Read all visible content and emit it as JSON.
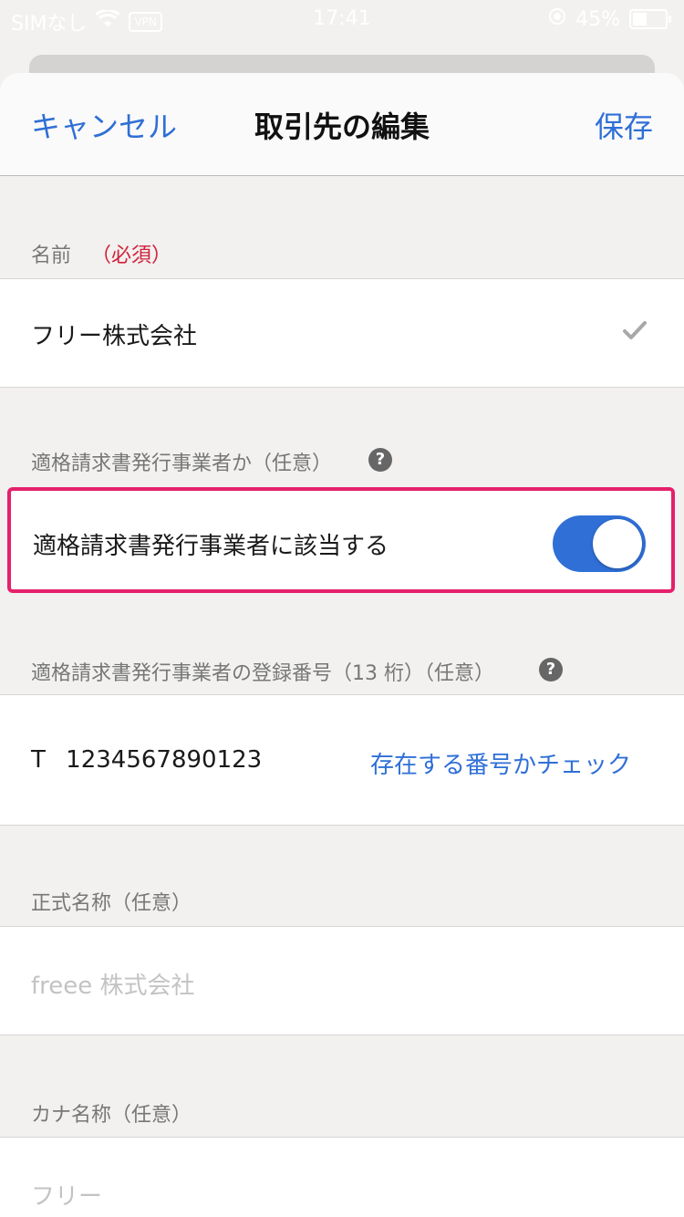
{
  "status_bar": {
    "carrier": "SIMなし",
    "vpn": "VPN",
    "time": "17:41",
    "battery": "45%",
    "battery_level": 0.45
  },
  "navbar": {
    "cancel": "キャンセル",
    "title": "取引先の編集",
    "save": "保存"
  },
  "name_section": {
    "label": "名前",
    "required": "（必須）",
    "value": "フリー株式会社"
  },
  "invoice_section": {
    "label": "適格請求書発行事業者か（任意）",
    "toggle_label": "適格請求書発行事業者に該当する",
    "toggle_on": true
  },
  "registration_section": {
    "label": "適格請求書発行事業者の登録番号（13 桁）（任意）",
    "prefix": "T",
    "number": "1234567890123",
    "check_link": "存在する番号かチェック"
  },
  "official_name_section": {
    "label": "正式名称（任意）",
    "placeholder": "freee 株式会社"
  },
  "kana_section": {
    "label": "カナ名称（任意）",
    "placeholder": "フリー"
  },
  "colors": {
    "accent": "#2f6fd6",
    "required": "#d0203a",
    "highlight": "#e5206b"
  },
  "icons": {
    "help": "?",
    "check": "checkmark"
  }
}
